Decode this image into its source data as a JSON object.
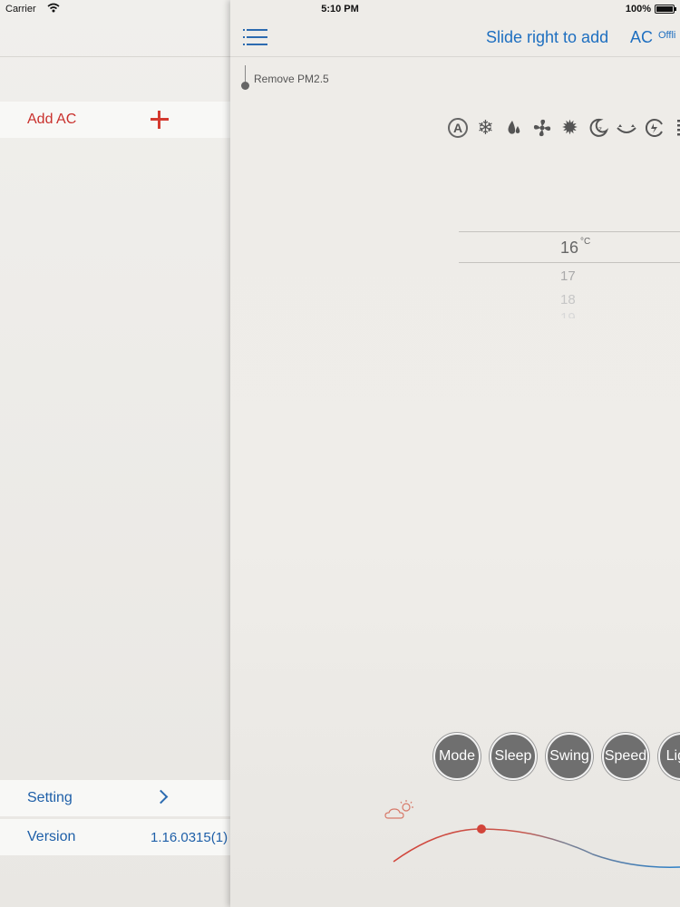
{
  "status_bar": {
    "carrier": "Carrier",
    "time": "5:10 PM",
    "battery": "100%"
  },
  "menu": {
    "add_ac": "Add AC",
    "setting": "Setting",
    "version_label": "Version",
    "version_value": "1.16.0315(1)"
  },
  "nav": {
    "title": "Slide right to add",
    "ac_label": "AC",
    "ac_status": "Offli"
  },
  "pm": {
    "label": "Remove PM2.5"
  },
  "mode_icons": [
    "auto-mode-icon",
    "cool-snowflake-icon",
    "dry-droplet-icon",
    "fan-icon",
    "heat-sun-icon",
    "sleep-moon-icon",
    "eco-icon",
    "turbo-icon",
    "display-bars-icon"
  ],
  "temperature": {
    "current": "16",
    "unit": "°C",
    "next1": "17",
    "next2": "18",
    "next3": "19"
  },
  "buttons": {
    "mode": "Mode",
    "sleep": "Sleep",
    "swing": "Swing",
    "speed": "Speed",
    "light": "Light"
  },
  "colors": {
    "accent_blue": "#1e6fc0",
    "accent_red": "#d43a2f",
    "button_gray": "#6f6f6f"
  }
}
